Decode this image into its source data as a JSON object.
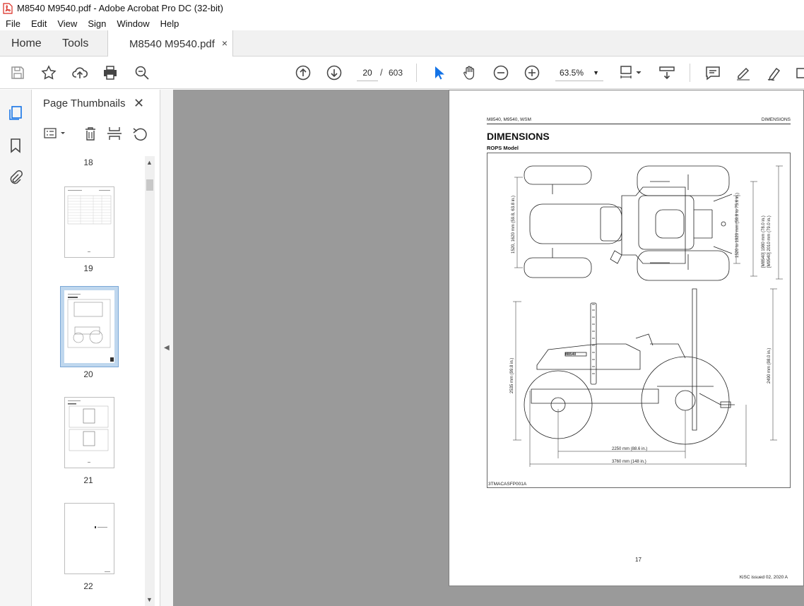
{
  "window": {
    "title": "M8540 M9540.pdf - Adobe Acrobat Pro DC (32-bit)"
  },
  "menu": [
    "File",
    "Edit",
    "View",
    "Sign",
    "Window",
    "Help"
  ],
  "tabs": {
    "home": "Home",
    "tools": "Tools",
    "document": "M8540 M9540.pdf",
    "close": "×"
  },
  "toolbar": {
    "current_page": "20",
    "page_separator": "/",
    "total_pages": "603",
    "zoom": "63.5%"
  },
  "thumbnails_panel": {
    "title": "Page Thumbnails",
    "pages": [
      {
        "label": "18"
      },
      {
        "label": "19"
      },
      {
        "label": "20",
        "selected": true
      },
      {
        "label": "21"
      },
      {
        "label": "22"
      }
    ]
  },
  "document_page": {
    "header_left": "M8540, M9540, WSM",
    "header_right": "DIMENSIONS",
    "title": "DIMENSIONS",
    "subtitle": "ROPS Model",
    "dimensions": {
      "top_left": "1520, 1620 mm (59.8, 63.8 in.)",
      "top_mid": "1520 to 1920 mm (59.8 to 75.6 in.)",
      "top_right_1": "[M8540] 1980 mm (78.0 in.)",
      "top_right_2": "[M9540] 2010 mm (79.0 in.)",
      "side_left": "2535 mm (99.8 in.)",
      "side_right": "2490 mm (98.0 in.)",
      "wheelbase": "2250 mm (88.6 in.)",
      "length": "3760 mm (148 in.)"
    },
    "brand_mark": "M8540",
    "figure_code": "3TMACASFP001A",
    "page_number": "17",
    "footer": "KiSC issued 02, 2020 A"
  },
  "colors": {
    "selection": "#bfd7ee",
    "viewport_bg": "#9a9a9a",
    "pointer_blue": "#1473e6"
  }
}
